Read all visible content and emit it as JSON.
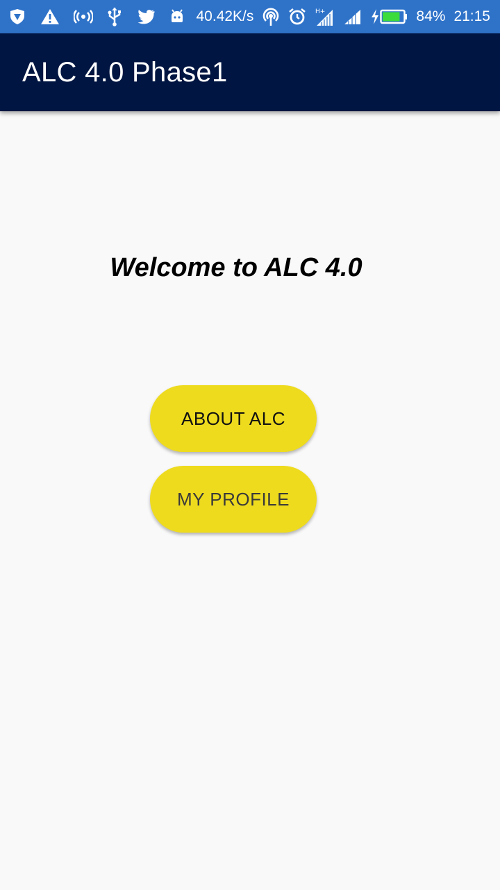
{
  "status_bar": {
    "network_speed": "40.42K/s",
    "battery_percent": "84%",
    "battery_level": 0.84,
    "time": "21:15",
    "icons_left": [
      "shield-icon",
      "warning-icon",
      "hotspot-icon",
      "usb-icon",
      "twitter-icon",
      "android-icon"
    ],
    "icons_right": [
      "nfc-icon",
      "alarm-icon",
      "signal-h-plus-icon",
      "signal-icon",
      "charging-icon",
      "battery-icon"
    ],
    "colors": {
      "background": "#2f73c9",
      "battery_fill": "#3ddc3d"
    }
  },
  "app_bar": {
    "title": "ALC 4.0 Phase1",
    "background": "#001541"
  },
  "main": {
    "welcome_text": "Welcome to ALC 4.0",
    "about_button_label": "ABOUT ALC",
    "profile_button_label": "MY PROFILE",
    "button_color": "#eedb1e"
  }
}
